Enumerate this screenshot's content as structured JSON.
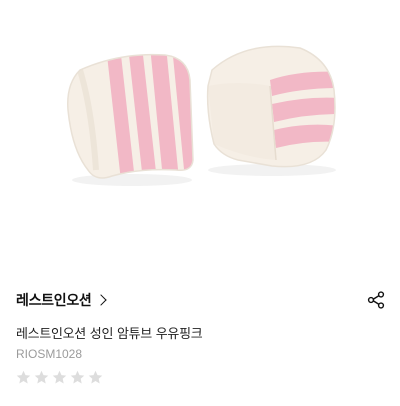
{
  "product": {
    "image_alt": "swim arm bands pink white stripes",
    "brand": "레스트인오션",
    "title": "레스트인오션 성인 암튜브 우유핑크",
    "code": "RIOSM1028",
    "rating": {
      "filled": 0,
      "max": 5
    }
  },
  "icons": {
    "brand_chevron": "chevron-right-icon",
    "share": "share-icon",
    "star": "star-icon"
  },
  "colors": {
    "stripe_pink": "#f2b8c6",
    "cream": "#f6efe6",
    "star_empty": "#dddddd",
    "code_gray": "#9b9b9b"
  }
}
